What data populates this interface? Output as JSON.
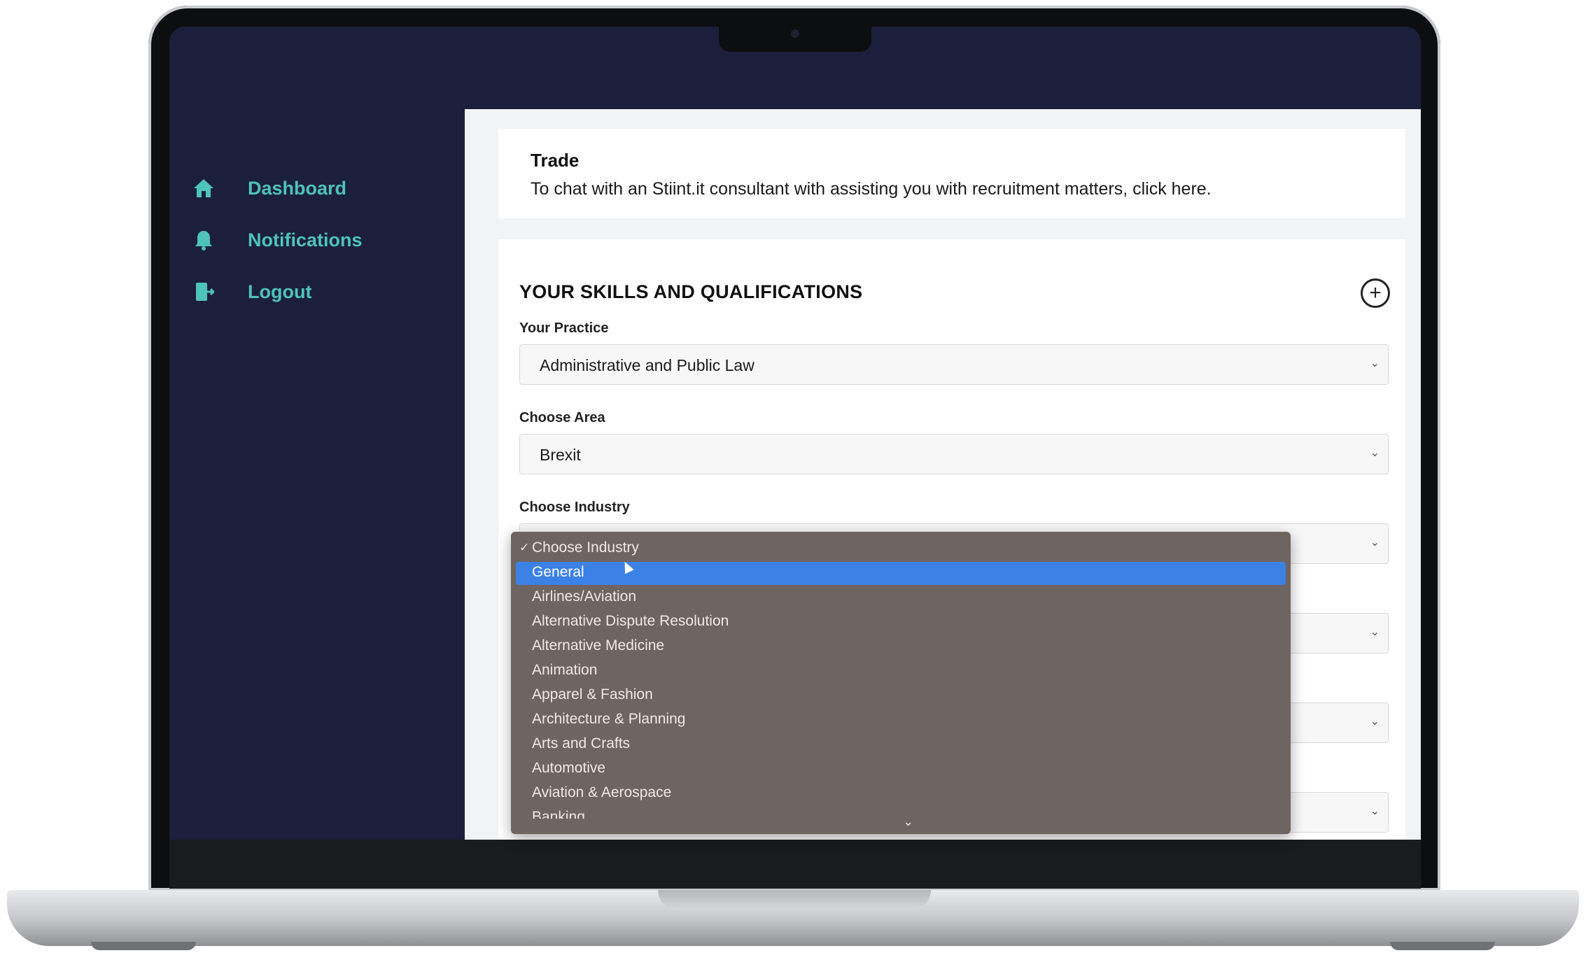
{
  "sidebar": {
    "items": [
      {
        "label": "Dashboard",
        "icon": "home-icon"
      },
      {
        "label": "Notifications",
        "icon": "bell-icon"
      },
      {
        "label": "Logout",
        "icon": "logout-icon"
      }
    ]
  },
  "trade": {
    "title": "Trade",
    "text": "To chat with an Stiint.it consultant with assisting you with recruitment matters, click here."
  },
  "skills": {
    "title": "YOUR SKILLS AND QUALIFICATIONS",
    "add_icon": "plus-circle-icon",
    "practice_label": "Your Practice",
    "practice_value": "Administrative and Public Law",
    "area_label": "Choose Area",
    "area_value": "Brexit",
    "industry_label": "Choose Industry"
  },
  "industry_dropdown": {
    "check": "✓",
    "selected": "Choose Industry",
    "options": [
      "General",
      "Airlines/Aviation",
      "Alternative Dispute Resolution",
      "Alternative Medicine",
      "Animation",
      "Apparel & Fashion",
      "Architecture & Planning",
      "Arts and Crafts",
      "Automotive",
      "Aviation & Aerospace",
      "Banking"
    ],
    "highlighted": "General"
  },
  "colors": {
    "sidebar_bg": "#1b1f3b",
    "accent": "#4ec3b8",
    "highlight": "#3c82e6"
  }
}
